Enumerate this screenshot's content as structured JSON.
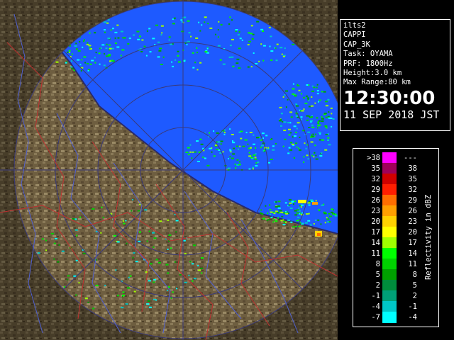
{
  "info": {
    "station": "ilts2",
    "product": "CAPPI",
    "product_code": "CAP_3K",
    "task": "Task: OYAMA",
    "prf": "PRF: 1800Hz",
    "height": "Height:3.0 km",
    "max_range": "Max Range:80 km",
    "time": "12:30:00",
    "date": "11 SEP 2018 JST"
  },
  "legend": {
    "unit_label": "Reflectivity in dBZ",
    "rows": [
      {
        "lo": ">38",
        "hi": "---",
        "color": "#ff00ff"
      },
      {
        "lo": "35",
        "hi": "38",
        "color": "#a0005a"
      },
      {
        "lo": "32",
        "hi": "35",
        "color": "#d00000"
      },
      {
        "lo": "29",
        "hi": "32",
        "color": "#ff1e00"
      },
      {
        "lo": "26",
        "hi": "29",
        "color": "#ff6e00"
      },
      {
        "lo": "23",
        "hi": "26",
        "color": "#ffa000"
      },
      {
        "lo": "20",
        "hi": "23",
        "color": "#ffd200"
      },
      {
        "lo": "17",
        "hi": "20",
        "color": "#ffff00"
      },
      {
        "lo": "14",
        "hi": "17",
        "color": "#a0ff00"
      },
      {
        "lo": "11",
        "hi": "14",
        "color": "#00ff00"
      },
      {
        "lo": "8",
        "hi": "11",
        "color": "#00d200"
      },
      {
        "lo": "5",
        "hi": "8",
        "color": "#00a000"
      },
      {
        "lo": "2",
        "hi": "5",
        "color": "#008c3c"
      },
      {
        "lo": "-1",
        "hi": "2",
        "color": "#00a078"
      },
      {
        "lo": "-4",
        "hi": "-1",
        "color": "#00c8c8"
      },
      {
        "lo": "-7",
        "hi": "-4",
        "color": "#00ffff"
      }
    ]
  },
  "colors": {
    "sea": "#1e5aff",
    "land": "#7a6a4a",
    "range_ring": "#3a3a7a"
  }
}
